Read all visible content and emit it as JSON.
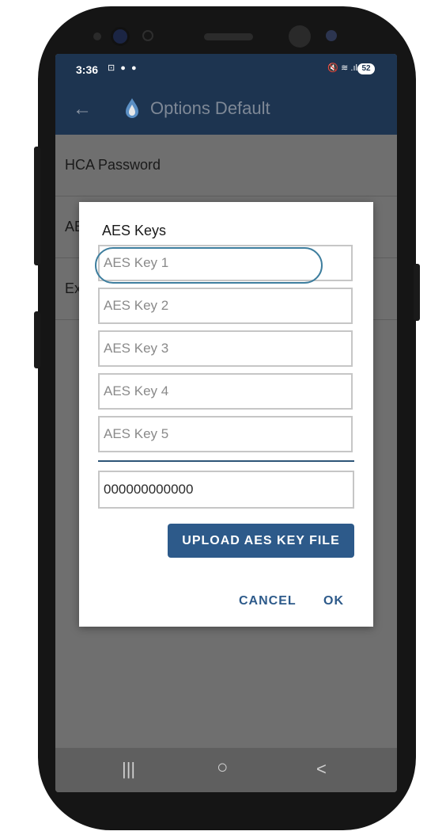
{
  "status_bar": {
    "time": "3:36",
    "left_icons": "⊡ ● ●",
    "right_icons": "🔇 ≋ .ıl",
    "battery": "52"
  },
  "toolbar": {
    "back_icon": "arrow-left",
    "title": "Options Default",
    "logo_color": "#4a90d9"
  },
  "background_list": {
    "rows": [
      "HCA Password",
      "AE",
      "Ex"
    ]
  },
  "dialog": {
    "title": "AES Keys",
    "keys": [
      {
        "placeholder": "AES Key 1"
      },
      {
        "placeholder": "AES Key 2"
      },
      {
        "placeholder": "AES Key 3"
      },
      {
        "placeholder": "AES Key 4"
      },
      {
        "placeholder": "AES Key 5"
      }
    ],
    "value": "000000000000",
    "upload_label": "UPLOAD AES KEY FILE",
    "cancel_label": "CANCEL",
    "ok_label": "OK"
  },
  "nav_bar": {
    "recents": "|||",
    "home": "○",
    "back": "<"
  },
  "colors": {
    "primary": "#1d3450",
    "accent": "#2d5a8a"
  }
}
